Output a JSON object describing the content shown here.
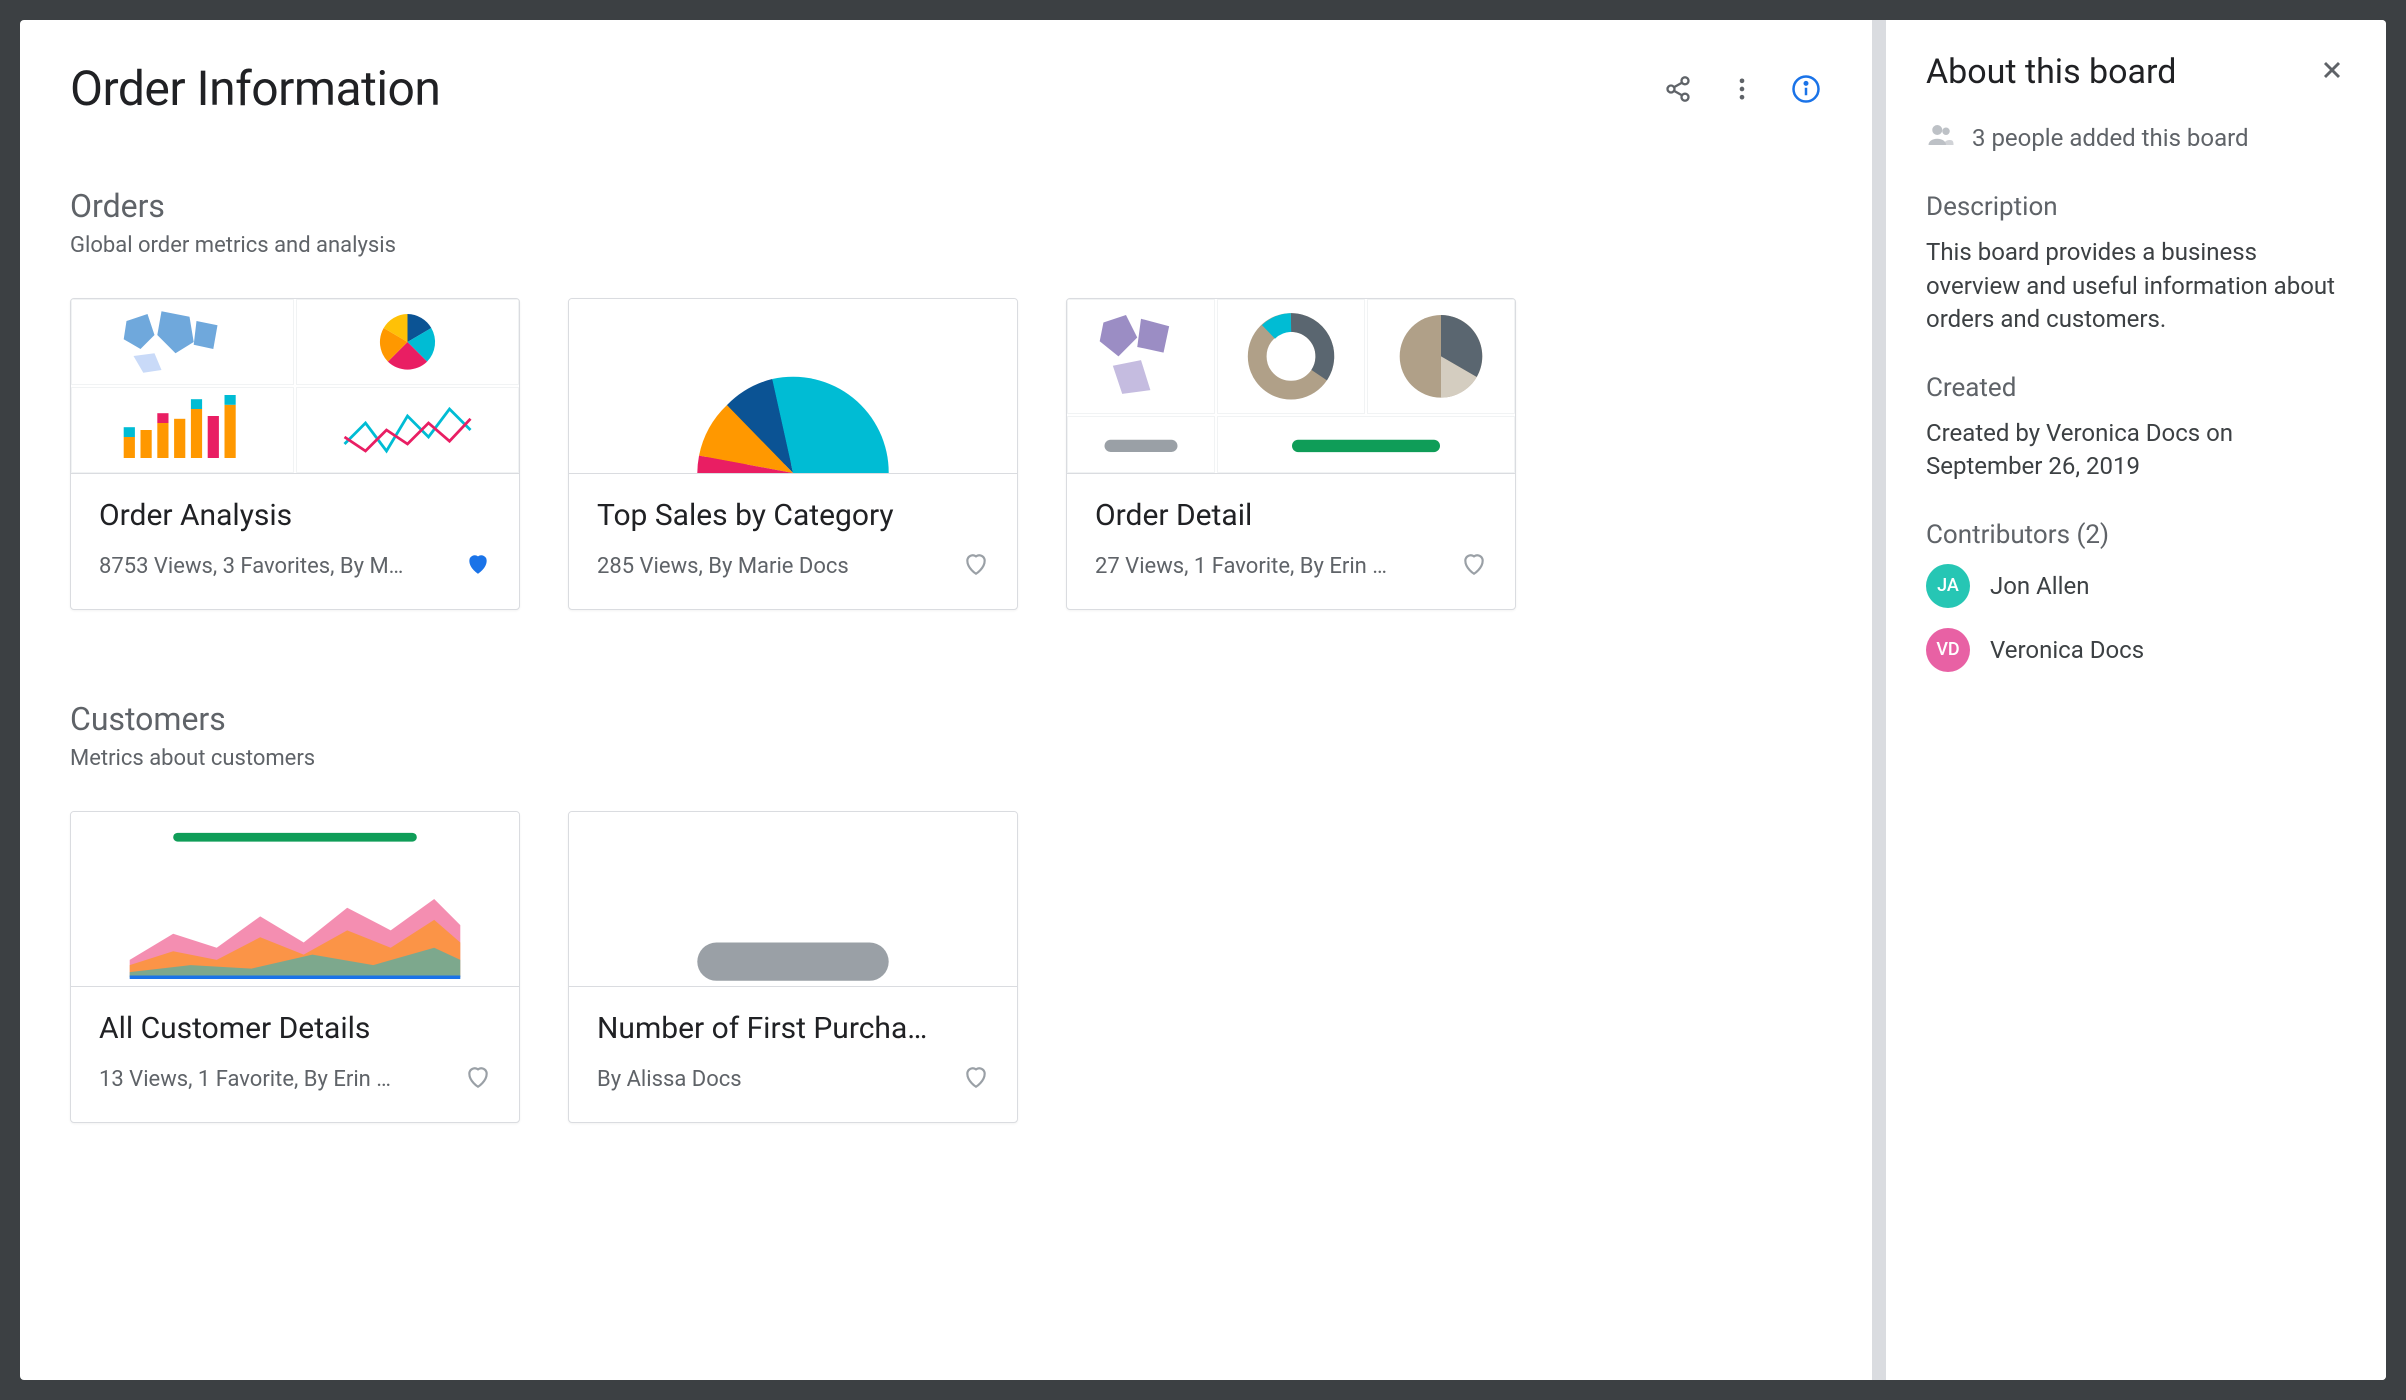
{
  "page": {
    "title": "Order Information"
  },
  "sections": [
    {
      "title": "Orders",
      "subtitle": "Global order metrics and analysis",
      "cards": [
        {
          "title": "Order Analysis",
          "meta": "8753 Views, 3 Favorites, By M…",
          "favorited": true
        },
        {
          "title": "Top Sales by Category",
          "meta": "285 Views, By Marie Docs",
          "favorited": false
        },
        {
          "title": "Order Detail",
          "meta": "27 Views, 1 Favorite, By Erin …",
          "favorited": false
        }
      ]
    },
    {
      "title": "Customers",
      "subtitle": "Metrics about customers",
      "cards": [
        {
          "title": "All Customer Details",
          "meta": "13 Views, 1 Favorite, By Erin …",
          "favorited": false
        },
        {
          "title": "Number of First Purcha…",
          "meta": "By Alissa Docs",
          "favorited": false
        }
      ]
    }
  ],
  "about": {
    "title": "About this board",
    "people_text": "3 people added this board",
    "description_label": "Description",
    "description": "This board provides a business overview and useful information about orders and customers.",
    "created_label": "Created",
    "created_text": "Created by Veronica Docs on September 26, 2019",
    "contributors_label": "Contributors (2)",
    "contributors": [
      {
        "initials": "JA",
        "name": "Jon Allen",
        "color": "teal"
      },
      {
        "initials": "VD",
        "name": "Veronica Docs",
        "color": "pink"
      }
    ]
  }
}
